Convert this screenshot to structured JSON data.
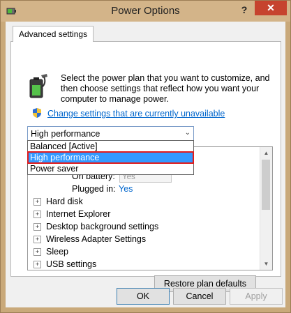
{
  "window": {
    "title": "Power Options",
    "help_glyph": "?",
    "close_glyph": "✕"
  },
  "tab": {
    "label": "Advanced settings"
  },
  "intro": {
    "text": "Select the power plan that you want to customize, and then choose settings that reflect how you want your computer to manage power."
  },
  "change_link": "Change settings that are currently unavailable",
  "plan_combo": {
    "selected": "High performance",
    "options": [
      "Balanced [Active]",
      "High performance",
      "Power saver"
    ],
    "highlighted_index": 1
  },
  "tree": {
    "sub_settings": [
      {
        "label": "On battery:",
        "value": "Yes",
        "disabled": true
      },
      {
        "label": "Plugged in:",
        "value": "Yes",
        "disabled": false
      }
    ],
    "items": [
      {
        "label": "Hard disk"
      },
      {
        "label": "Internet Explorer"
      },
      {
        "label": "Desktop background settings"
      },
      {
        "label": "Wireless Adapter Settings"
      },
      {
        "label": "Sleep"
      },
      {
        "label": "USB settings"
      }
    ]
  },
  "buttons": {
    "restore": "Restore plan defaults",
    "ok": "OK",
    "cancel": "Cancel",
    "apply": "Apply"
  },
  "colors": {
    "title_bar": "#d3b489",
    "close_button": "#c6432e",
    "link": "#0066cc",
    "selection": "#3399ff",
    "highlight_border": "#e21b1b"
  }
}
